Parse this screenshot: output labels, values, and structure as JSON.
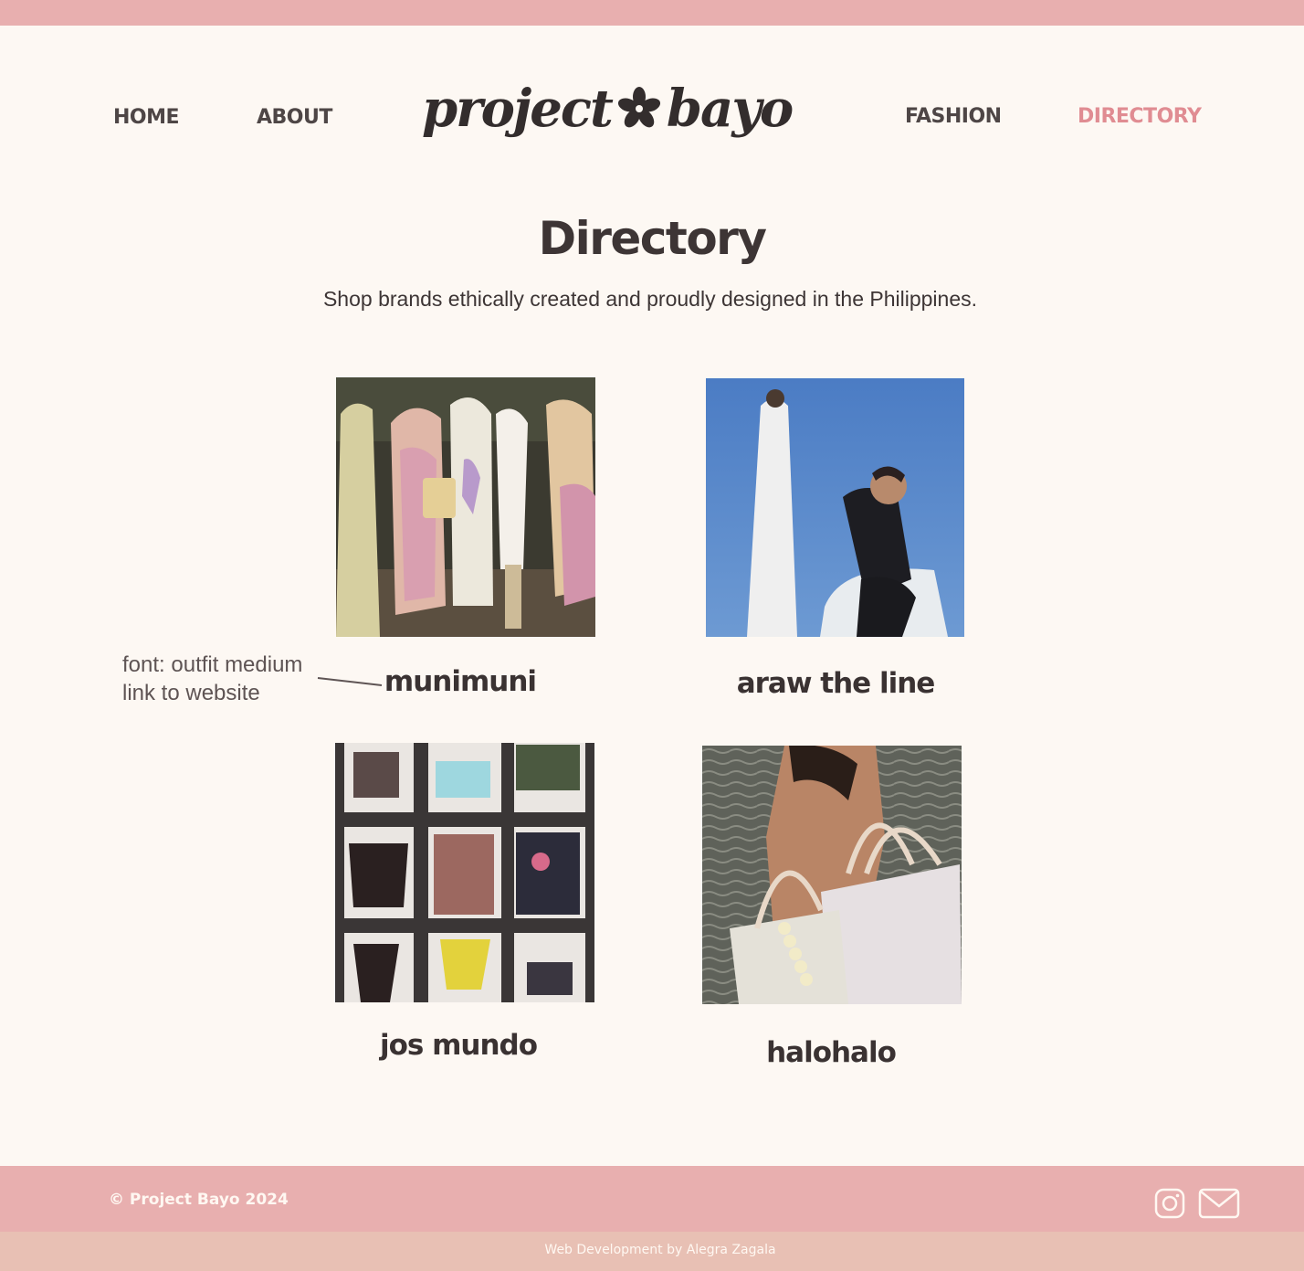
{
  "nav": {
    "home": "HOME",
    "about": "ABOUT",
    "fashion": "FASHION",
    "directory": "DIRECTORY"
  },
  "logo": {
    "left_word": "project",
    "right_word": "bayo"
  },
  "page": {
    "title": "Directory",
    "subtitle": "Shop brands ethically created and proudly designed in the Philippines."
  },
  "brands": [
    {
      "name": "munimuni"
    },
    {
      "name": "araw the line"
    },
    {
      "name": "jos mundo"
    },
    {
      "name": "halohalo"
    }
  ],
  "annotation": {
    "line1": "font: outfit medium",
    "line2": "link to website"
  },
  "footer": {
    "copyright": "© Project Bayo 2024",
    "credit": "Web Development by Alegra Zagala"
  },
  "colors": {
    "background": "#fdf8f3",
    "accent_pink": "#e8afaf",
    "active_nav": "#e08c92",
    "sub_footer": "#e8c0b4",
    "text_dark": "#3d3535"
  },
  "icons": [
    "flower-icon",
    "instagram-icon",
    "mail-icon"
  ]
}
